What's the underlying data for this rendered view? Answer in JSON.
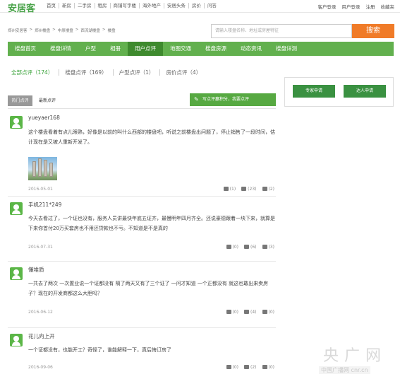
{
  "brand": {
    "logo_text": "安居客",
    "accent": "#62b04e",
    "search_accent": "#f07b28"
  },
  "topnav": [
    "首页",
    "新房",
    "二手房",
    "租房",
    "商铺写字楼",
    "海外地产",
    "安居头条",
    "房价",
    "问答"
  ],
  "topright": {
    "login_menu": "客户登录",
    "user_login": "用户登录",
    "register": "注册",
    "favorites": "收藏夹"
  },
  "breadcrumb": [
    "郑州安居客",
    ">",
    "郑州楼盘",
    ">",
    "中原楼盘",
    ">",
    "西流湖楼盘",
    ">",
    "楼盘"
  ],
  "search": {
    "placeholder": "请输入楼盘名称、地址或房屋特征",
    "button": "搜索"
  },
  "mainnav": [
    "楼盘首页",
    "楼盘详情",
    "户型",
    "相册",
    "用户点评",
    "地图交通",
    "楼盘房源",
    "动态资讯",
    "楼盘详测"
  ],
  "mainnav_active_index": 4,
  "subtabs": [
    "全部点评（174）",
    "楼盘点评（169）",
    "户型点评（1）",
    "房价点评（4）"
  ],
  "list_tabs": {
    "hot": "热门点评",
    "latest": "最新点评"
  },
  "write_button": "写点评赢积分，我要点评",
  "side": {
    "expert": "专家申请",
    "person": "达人申请"
  },
  "reviews": [
    {
      "user": "yueyaer168",
      "text": "这个楼盘看着有点儿眼熟，好像是以前的叫什么西部的楼盘吧，听说之前楼盘出问题了，停止销售了一段时间，估计现在是又被人重新开发了。",
      "date": "2016-05-01",
      "comments": "(1)",
      "likes": "(23)",
      "dislikes": "(2)"
    },
    {
      "user": "手机211*249",
      "text": "今天去看过了，一个证也没有，服务人员讲最快年底五证齐，最慢明年四月齐全。还说豪德跟着一块下来，就算是下来你首付20万买套房也不用还贷款也不亏。不知道是不是真的",
      "date": "2016-07-31",
      "comments": "(0)",
      "likes": "(6)",
      "dislikes": "(3)"
    },
    {
      "user": "懂堆质",
      "text": "一共去了两次 一次置业说一个证都没有 隔了两天又有了三个证了 一问才知道 一个正都没有 就这也敢出来卖房子？现在的开发商都这么大胆吗？",
      "date": "2016-06-12",
      "comments": "(0)",
      "likes": "(4)",
      "dislikes": "(0)"
    },
    {
      "user": "花儿向上开",
      "text": "一个证都没有，也能开工？奇怪了，谁能解释一下，真后悔订房了",
      "date": "2016-09-06",
      "comments": "(0)",
      "likes": "(2)",
      "dislikes": "(0)"
    }
  ],
  "watermark": {
    "big": "央广网",
    "small": "中国广播网 cnr.cn"
  }
}
